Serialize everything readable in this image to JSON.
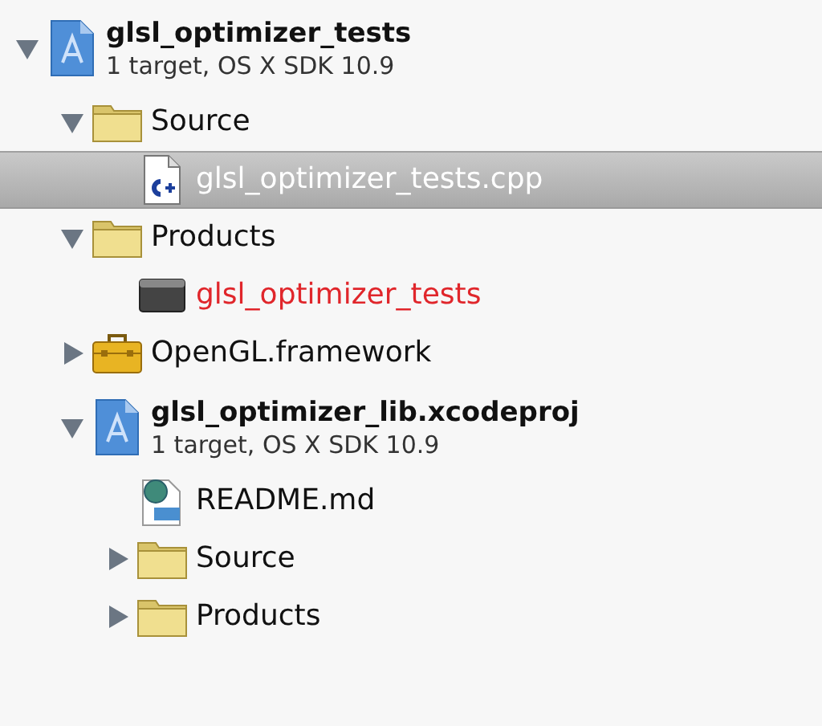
{
  "navigator": {
    "items": [
      {
        "kind": "project",
        "label": "glsl_optimizer_tests",
        "subtitle": "1 target, OS X SDK 10.9",
        "expanded": true,
        "selected": false,
        "children": [
          {
            "kind": "folder",
            "label": "Source",
            "expanded": true,
            "selected": false,
            "children": [
              {
                "kind": "cpp",
                "label": "glsl_optimizer_tests.cpp",
                "selected": true
              }
            ]
          },
          {
            "kind": "folder",
            "label": "Products",
            "expanded": true,
            "selected": false,
            "children": [
              {
                "kind": "product",
                "label": "glsl_optimizer_tests",
                "missing": true,
                "selected": false
              }
            ]
          },
          {
            "kind": "framework",
            "label": "OpenGL.framework",
            "expanded": false,
            "selected": false
          },
          {
            "kind": "project",
            "label": "glsl_optimizer_lib.xcodeproj",
            "subtitle": "1 target, OS X SDK 10.9",
            "expanded": true,
            "selected": false,
            "children": [
              {
                "kind": "markdown",
                "label": "README.md",
                "selected": false
              },
              {
                "kind": "folder",
                "label": "Source",
                "expanded": false,
                "selected": false
              },
              {
                "kind": "folder",
                "label": "Products",
                "expanded": false,
                "selected": false
              }
            ]
          }
        ]
      }
    ]
  }
}
